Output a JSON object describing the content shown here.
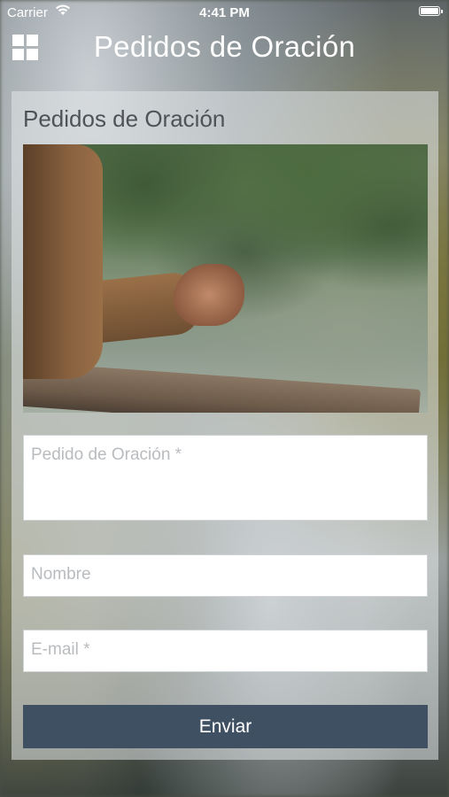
{
  "status_bar": {
    "carrier": "Carrier",
    "time": "4:41 PM"
  },
  "nav": {
    "title": "Pedidos de Oración",
    "menu_icon": "grid-menu-icon"
  },
  "card": {
    "title": "Pedidos de Oración",
    "image_alt_icon": "praying-hands-photo",
    "fields": {
      "prayer_request_placeholder": "Pedido de Oración  *",
      "name_placeholder": "Nombre",
      "email_placeholder": "E-mail *"
    },
    "submit_label": "Enviar"
  },
  "colors": {
    "button": "#3f5062",
    "title_text": "#4f5257"
  }
}
